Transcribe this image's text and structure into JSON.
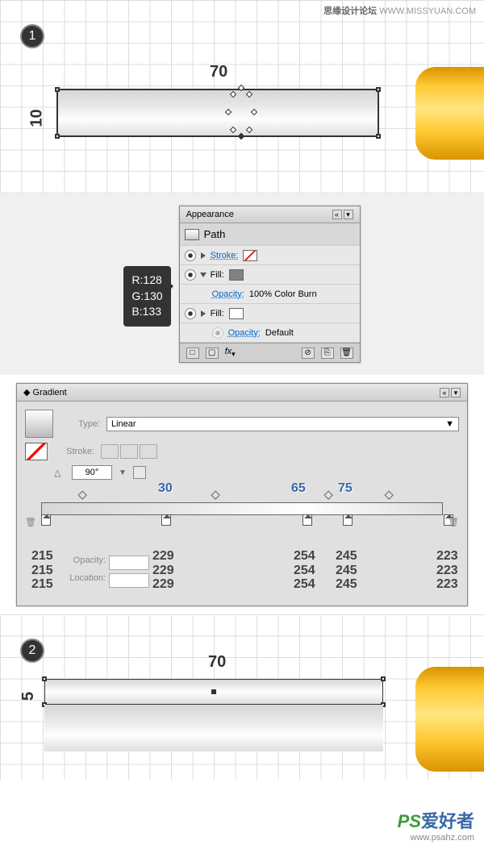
{
  "watermark_top": {
    "title": "思缘设计论坛",
    "url": "WWW.MISSYUAN.COM"
  },
  "watermark_bottom": {
    "logo1": "PS",
    "logo2": "爱好者",
    "url": "www.psahz.com"
  },
  "step1": {
    "num": "1",
    "dim_w": "70",
    "dim_h": "10"
  },
  "step2": {
    "num": "2",
    "dim_w": "70",
    "dim_h": "5"
  },
  "rgb": {
    "r": "R:128",
    "g": "G:130",
    "b": "B:133"
  },
  "appearance": {
    "title": "Appearance",
    "path": "Path",
    "stroke_label": "Stroke:",
    "fill_label": "Fill:",
    "opacity_label": "Opacity:",
    "opacity1": "100% Color Burn",
    "opacity2": "Default",
    "fx": "fx"
  },
  "gradient": {
    "title": "Gradient",
    "type_label": "Type:",
    "type_value": "Linear",
    "stroke_label": "Stroke:",
    "angle": "90°",
    "opacity_label": "Opacity:",
    "location_label": "Location:",
    "midpoints": [
      {
        "pos": 30,
        "label": "30"
      },
      {
        "pos": 65,
        "label": "65"
      },
      {
        "pos": 75,
        "label": "75"
      }
    ],
    "stops": [
      {
        "pos": 0,
        "vals": [
          "215",
          "215",
          "215"
        ]
      },
      {
        "pos": 30,
        "vals": [
          "229",
          "229",
          "229"
        ]
      },
      {
        "pos": 65,
        "vals": [
          "254",
          "254",
          "254"
        ]
      },
      {
        "pos": 75,
        "vals": [
          "245",
          "245",
          "245"
        ]
      },
      {
        "pos": 100,
        "vals": [
          "223",
          "223",
          "223"
        ]
      }
    ]
  },
  "chart_data": {
    "type": "table",
    "title": "Gradient color stops (RGB)",
    "columns": [
      "Location %",
      "R",
      "G",
      "B"
    ],
    "rows": [
      [
        0,
        215,
        215,
        215
      ],
      [
        30,
        229,
        229,
        229
      ],
      [
        65,
        254,
        254,
        254
      ],
      [
        75,
        245,
        245,
        245
      ],
      [
        100,
        223,
        223,
        223
      ]
    ],
    "midpoints": [
      30,
      65,
      75
    ],
    "angle": 90,
    "fill_rgb": [
      128,
      130,
      133
    ]
  }
}
